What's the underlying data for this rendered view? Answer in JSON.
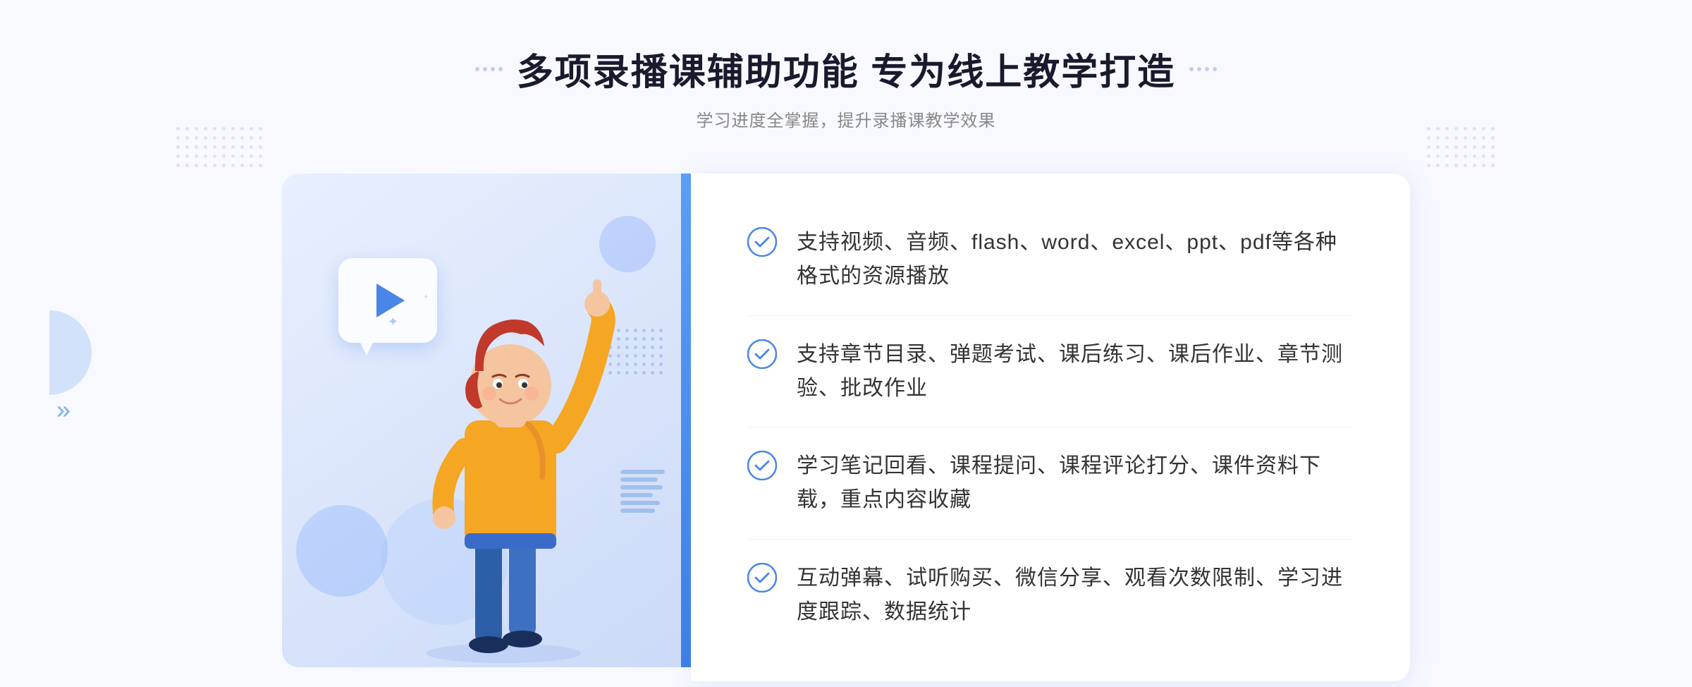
{
  "header": {
    "title": "多项录播课辅助功能 专为线上教学打造",
    "subtitle": "学习进度全掌握，提升录播课教学效果",
    "decorator_left": "⁞⁞",
    "decorator_right": "⁞⁞"
  },
  "features": [
    {
      "id": 1,
      "text": "支持视频、音频、flash、word、excel、ppt、pdf等各种格式的资源播放"
    },
    {
      "id": 2,
      "text": "支持章节目录、弹题考试、课后练习、课后作业、章节测验、批改作业"
    },
    {
      "id": 3,
      "text": "学习笔记回看、课程提问、课程评论打分、课件资料下载，重点内容收藏"
    },
    {
      "id": 4,
      "text": "互动弹幕、试听购买、微信分享、观看次数限制、学习进度跟踪、数据统计"
    }
  ],
  "colors": {
    "accent_blue": "#4a85e8",
    "light_blue": "#e8f0fe",
    "text_dark": "#1a1a2e",
    "text_gray": "#888888",
    "text_feature": "#333333"
  }
}
